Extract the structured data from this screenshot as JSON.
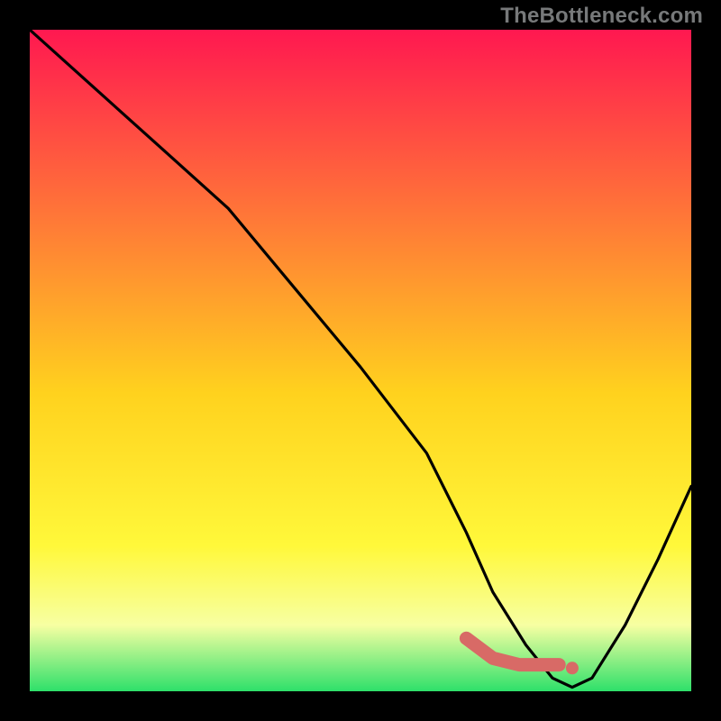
{
  "watermark": "TheBottleneck.com",
  "colors": {
    "bg": "#000000",
    "grad_top": "#ff1850",
    "grad_mid_upper": "#ff7d36",
    "grad_mid": "#ffd21e",
    "grad_mid_lower": "#fff83a",
    "grad_lower": "#f7ffa2",
    "grad_bottom": "#2ee06a",
    "curve": "#000000",
    "marker": "#d86a66"
  },
  "chart_data": {
    "type": "line",
    "title": "",
    "xlabel": "",
    "ylabel": "",
    "xlim": [
      0,
      100
    ],
    "ylim": [
      0,
      100
    ],
    "x": [
      0,
      10,
      20,
      30,
      40,
      50,
      60,
      66,
      70,
      75,
      79,
      82,
      85,
      90,
      95,
      100
    ],
    "values": [
      100,
      91,
      82,
      73,
      61,
      49,
      36,
      24,
      15,
      7,
      2,
      0.6,
      2,
      10,
      20,
      31
    ],
    "marker_segment": {
      "x": [
        66,
        70,
        74,
        77,
        79,
        80
      ],
      "y": [
        8,
        5,
        4,
        4,
        4,
        4
      ]
    },
    "marker_dots": {
      "x": [
        82
      ],
      "y": [
        3.5
      ]
    }
  }
}
